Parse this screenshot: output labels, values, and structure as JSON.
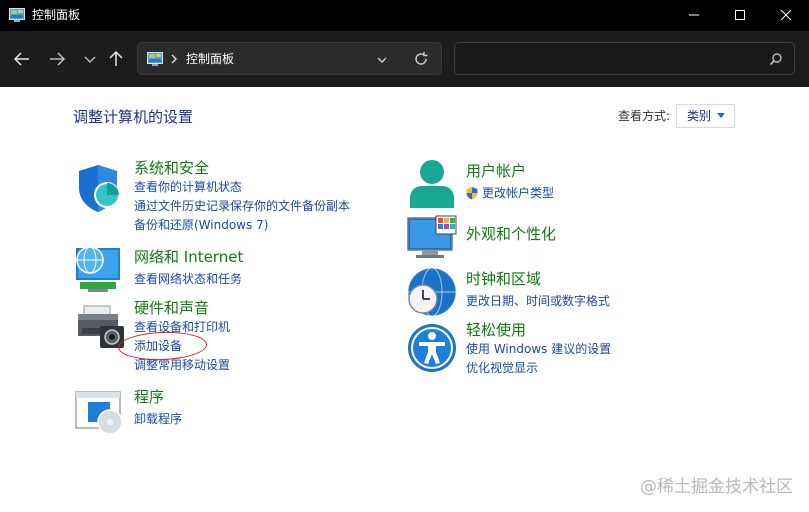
{
  "window": {
    "title": "控制面板"
  },
  "navbar": {
    "address_text": "控制面板",
    "search_placeholder": ""
  },
  "content": {
    "page_title": "调整计算机的设置",
    "view_by_label": "查看方式:",
    "view_by_value": "类别"
  },
  "categories": {
    "system_security": {
      "title": "系统和安全",
      "links": [
        "查看你的计算机状态",
        "通过文件历史记录保存你的文件备份副本",
        "备份和还原(Windows 7)"
      ]
    },
    "network": {
      "title": "网络和 Internet",
      "links": [
        "查看网络状态和任务"
      ]
    },
    "hardware": {
      "title": "硬件和声音",
      "links": [
        "查看设备和打印机",
        "添加设备",
        "调整常用移动设置"
      ]
    },
    "programs": {
      "title": "程序",
      "links": [
        "卸载程序"
      ]
    },
    "user_accounts": {
      "title": "用户帐户",
      "links": [
        "更改帐户类型"
      ]
    },
    "appearance": {
      "title": "外观和个性化",
      "links": []
    },
    "clock_region": {
      "title": "时钟和区域",
      "links": [
        "更改日期、时间或数字格式"
      ]
    },
    "ease_of_access": {
      "title": "轻松使用",
      "links": [
        "使用 Windows 建议的设置",
        "优化视觉显示"
      ]
    }
  },
  "watermark": "@稀土掘金技术社区",
  "icons": {
    "title": "control-panel-icon",
    "back": "arrow-left-icon",
    "forward": "arrow-right-icon",
    "recent": "chevron-down-icon",
    "up": "arrow-up-icon",
    "refresh": "refresh-icon",
    "search": "search-icon"
  },
  "colors": {
    "titlebar": "#000000",
    "navbar": "#1c1c1c",
    "category_title": "#107c10",
    "link": "#1a4ba6",
    "heading": "#1e3287",
    "annotation": "#d62020"
  }
}
